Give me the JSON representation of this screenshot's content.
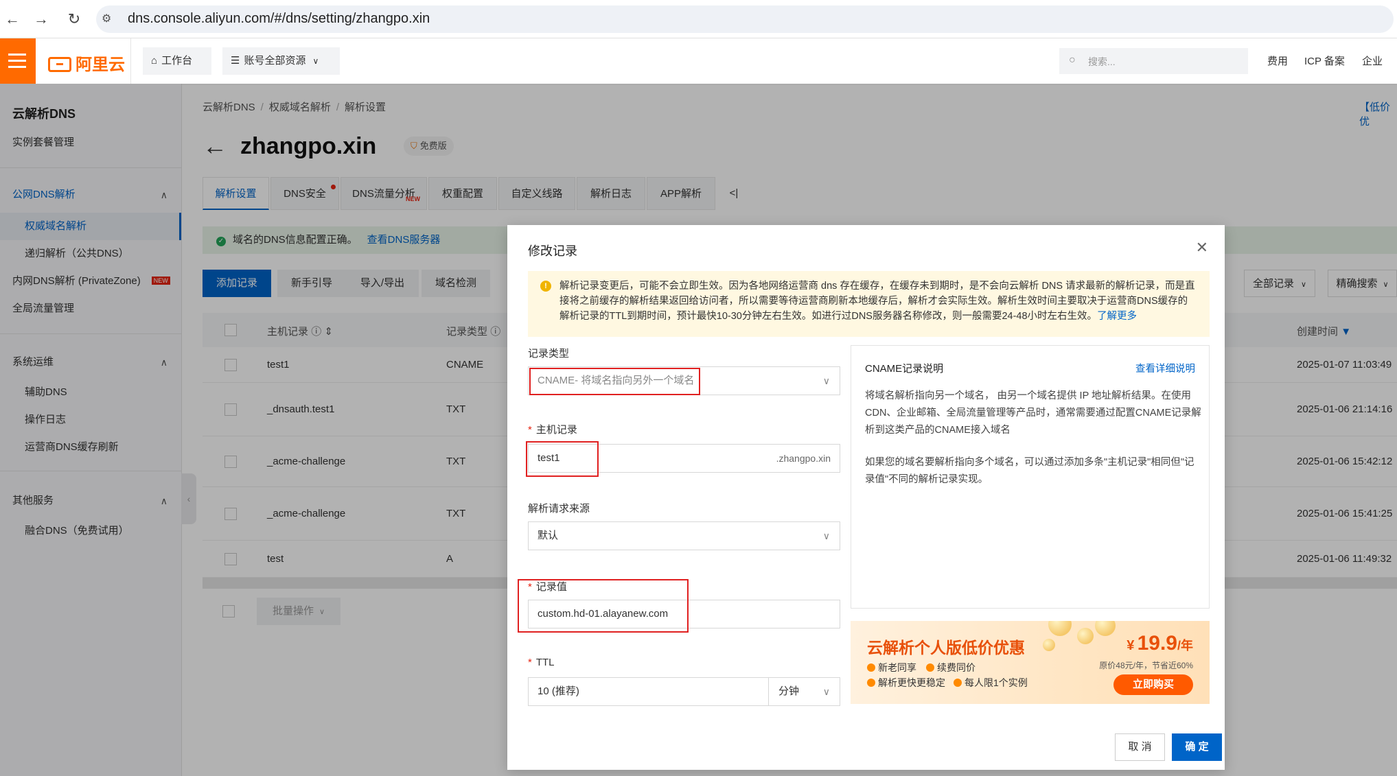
{
  "browser": {
    "url": "dns.console.aliyun.com/#/dns/setting/zhangpo.xin",
    "back_icon": "←",
    "forward_icon": "→",
    "reload_icon": "↻",
    "site_icon": "⚙"
  },
  "header": {
    "logo_text": "阿里云",
    "workbench": "工作台",
    "resources": "账号全部资源",
    "search_placeholder": "搜索...",
    "links": [
      "费用",
      "ICP 备案",
      "企业"
    ]
  },
  "sidebar": {
    "title": "云解析DNS",
    "instance_pkg": "实例套餐管理",
    "public_dns": "公网DNS解析",
    "authoritative": "权威域名解析",
    "recursive": "递归解析（公共DNS）",
    "private_zone": "内网DNS解析 (PrivateZone)",
    "private_badge": "NEW",
    "gtm": "全局流量管理",
    "ops": "系统运维",
    "aux_dns": "辅助DNS",
    "op_log": "操作日志",
    "isp_refresh": "运营商DNS缓存刷新",
    "other": "其他服务",
    "fusion": "融合DNS（免费试用）"
  },
  "main": {
    "breadcrumb": [
      "云解析DNS",
      "权威域名解析",
      "解析设置"
    ],
    "title": "zhangpo.xin",
    "free_badge": "免费版",
    "top_right_link": "【低价优",
    "tabs": [
      "解析设置",
      "DNS安全",
      "DNS流量分析",
      "权重配置",
      "自定义线路",
      "解析日志",
      "APP解析",
      "<|"
    ],
    "tab_new_badge": "NEW",
    "notice": "域名的DNS信息配置正确。",
    "notice_link": "查看DNS服务器",
    "actions": [
      "添加记录",
      "新手引导",
      "导入/导出",
      "域名检测"
    ],
    "filter_all": "全部记录",
    "filter_exact": "精确搜索",
    "columns": [
      "主机记录",
      "记录类型",
      "创建时间"
    ],
    "rows": [
      {
        "host": "test1",
        "type": "CNAME",
        "created": "2025-01-07 11:03:49"
      },
      {
        "host": "_dnsauth.test1",
        "type": "TXT",
        "created": "2025-01-06 21:14:16"
      },
      {
        "host": "_acme-challenge",
        "type": "TXT",
        "created": "2025-01-06 15:42:12"
      },
      {
        "host": "_acme-challenge",
        "type": "TXT",
        "created": "2025-01-06 15:41:25"
      },
      {
        "host": "test",
        "type": "A",
        "created": "2025-01-06 11:49:32"
      }
    ],
    "batch": "批量操作"
  },
  "modal": {
    "title": "修改记录",
    "warning": "解析记录变更后，可能不会立即生效。因为各地网络运营商 dns 存在缓存，在缓存未到期时，是不会向云解析 DNS 请求最新的解析记录，而是直接将之前缓存的解析结果返回给访问者，所以需要等待运营商刷新本地缓存后，解析才会实际生效。解析生效时间主要取决于运营商DNS缓存的解析记录的TTL到期时间，预计最快10-30分钟左右生效。如进行过DNS服务器名称修改，则一般需要24-48小时左右生效。",
    "warning_link": "了解更多",
    "record_type_label": "记录类型",
    "record_type_value": "CNAME- 将域名指向另外一个域名",
    "host_label": "主机记录",
    "host_value": "test1",
    "host_suffix": ".zhangpo.xin",
    "source_label": "解析请求来源",
    "source_value": "默认",
    "value_label": "记录值",
    "value_value": "custom.hd-01.alayanew.com",
    "ttl_label": "TTL",
    "ttl_value": "10 (推荐)",
    "ttl_unit": "分钟",
    "info_title": "CNAME记录说明",
    "info_link": "查看详细说明",
    "info_p1": "将域名解析指向另一个域名， 由另一个域名提供 IP 地址解析结果。在使用 CDN、企业邮箱、全局流量管理等产品时，通常需要通过配置CNAME记录解析到这类产品的CNAME接入域名",
    "info_p2": "如果您的域名要解析指向多个域名，可以通过添加多条\"主机记录\"相同但\"记录值\"不同的解析记录实现。",
    "promo_title": "云解析个人版低价优惠",
    "promo_features": [
      "新老同享",
      "续费同价",
      "解析更快更稳定",
      "每人限1个实例"
    ],
    "promo_currency": "¥",
    "promo_price": "19.9",
    "promo_unit": "/年",
    "promo_orig": "原价48元/年，节省近60%",
    "promo_buy": "立即购买",
    "cancel": "取 消",
    "confirm": "确 定"
  },
  "colors": {
    "brand_orange": "#ff6a00",
    "primary_blue": "#0064c8",
    "highlight_red": "#e02020"
  }
}
